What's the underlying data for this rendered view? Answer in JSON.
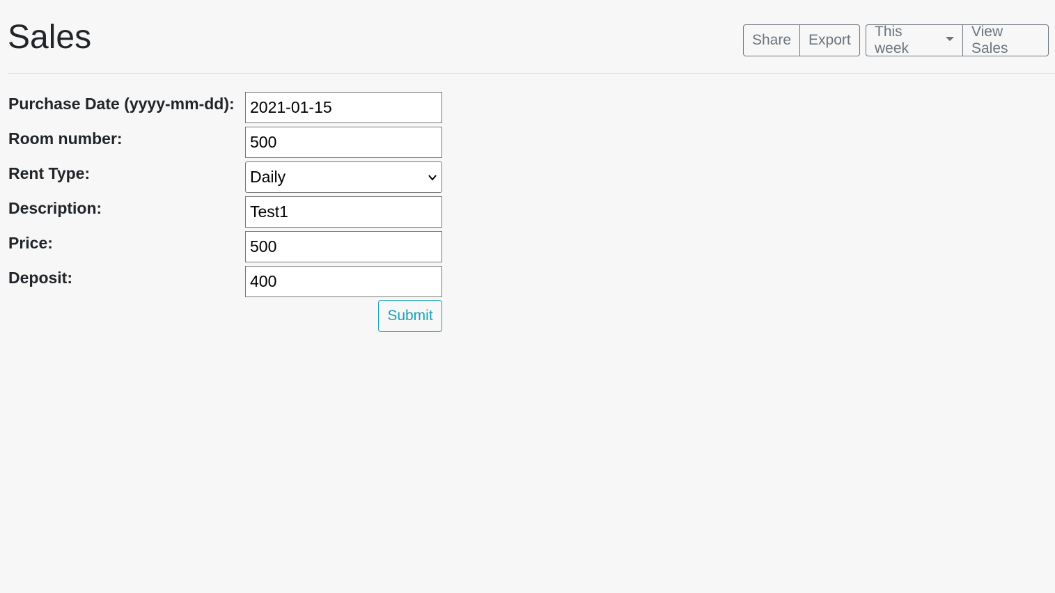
{
  "header": {
    "title": "Sales",
    "toolbar": {
      "share_label": "Share",
      "export_label": "Export",
      "period_label": "This week",
      "view_sales_label": "View Sales"
    }
  },
  "form": {
    "purchase_date": {
      "label": "Purchase Date (yyyy-mm-dd):",
      "value": "2021-01-15"
    },
    "room_number": {
      "label": "Room number:",
      "value": "500"
    },
    "rent_type": {
      "label": "Rent Type:",
      "value": "Daily",
      "icon": "chevron-down-icon"
    },
    "description": {
      "label": "Description:",
      "value": "Test1"
    },
    "price": {
      "label": "Price:",
      "value": "500"
    },
    "deposit": {
      "label": "Deposit:",
      "value": "400"
    },
    "submit_label": "Submit"
  },
  "colors": {
    "background": "#f7f7f7",
    "secondary": "#6c757d",
    "info": "#17a2b8",
    "text": "#212529"
  }
}
